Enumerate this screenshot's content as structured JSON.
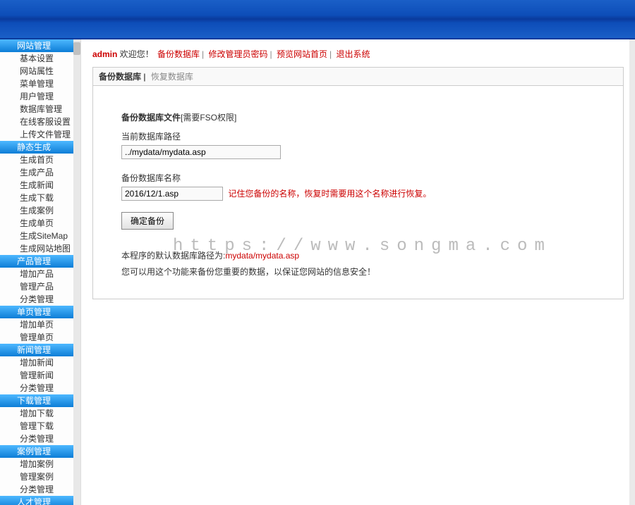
{
  "topbar": {
    "admin": "admin",
    "welcome": " 欢迎您！ ",
    "links": {
      "backup_db": "备份数据库",
      "change_pwd": "修改管理员密码",
      "preview_home": "预览网站首页",
      "logout": "退出系统"
    }
  },
  "sidebar": {
    "sections": [
      {
        "header": "网站管理",
        "items": [
          "基本设置",
          "网站属性",
          "菜单管理",
          "用户管理",
          "数据库管理",
          "在线客服设置",
          "上传文件管理"
        ]
      },
      {
        "header": "静态生成",
        "items": [
          "生成首页",
          "生成产品",
          "生成新闻",
          "生成下载",
          "生成案例",
          "生成单页",
          "生成SiteMap",
          "生成网站地图"
        ]
      },
      {
        "header": "产品管理",
        "items": [
          "增加产品",
          "管理产品",
          "分类管理"
        ]
      },
      {
        "header": "单页管理",
        "items": [
          "增加单页",
          "管理单页"
        ]
      },
      {
        "header": "新闻管理",
        "items": [
          "增加新闻",
          "管理新闻",
          "分类管理"
        ]
      },
      {
        "header": "下载管理",
        "items": [
          "增加下载",
          "管理下载",
          "分类管理"
        ]
      },
      {
        "header": "案例管理",
        "items": [
          "增加案例",
          "管理案例",
          "分类管理"
        ]
      },
      {
        "header": "人才管理",
        "items": []
      }
    ]
  },
  "panel": {
    "tab_active": "备份数据库",
    "tab_inactive": "恢复数据库",
    "form": {
      "title": "备份数据库文件",
      "title_suffix": "[需要FSO权限]",
      "current_path_label": "当前数据库路径",
      "current_path_value": "../mydata/mydata.asp",
      "backup_name_label": "备份数据库名称",
      "backup_name_value": "2016/12/1.asp",
      "backup_name_hint": "记住您备份的名称，恢复时需要用这个名称进行恢复。",
      "submit_label": "确定备份",
      "info1_prefix": "本程序的默认数据库路径为:",
      "info1_path": "mydata/mydata.asp",
      "info2": "您可以用这个功能来备份您重要的数据，以保证您网站的信息安全！"
    }
  },
  "watermark": "https://www.songma.com"
}
